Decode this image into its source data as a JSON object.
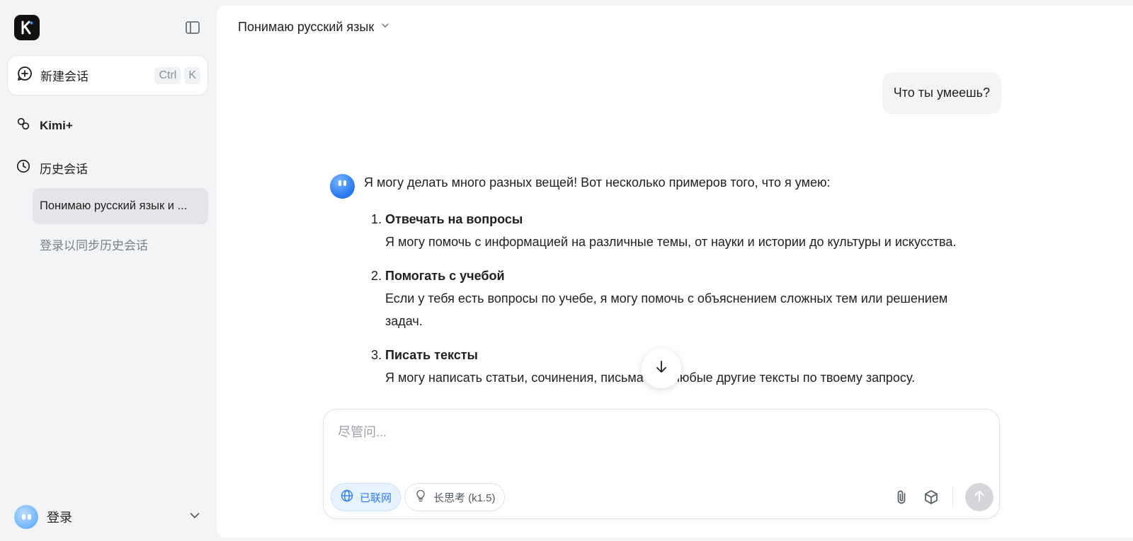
{
  "sidebar": {
    "new_chat_label": "新建会话",
    "shortcut_ctrl": "Ctrl",
    "shortcut_k": "K",
    "kimi_plus_label": "Kimi+",
    "history_label": "历史会话",
    "history_items": [
      {
        "label": "Понимаю русский язык и ..."
      }
    ],
    "login_sync_text": "登录以同步历史会话",
    "login_label": "登录"
  },
  "topbar": {
    "conversation_title": "Понимаю русский язык"
  },
  "conversation": {
    "user_message": "Что ты умеешь?",
    "assistant": {
      "intro": "Я могу делать много разных вещей! Вот несколько примеров того, что я умею:",
      "items": [
        {
          "number": "1.",
          "title": "Отвечать на вопросы",
          "text": "Я могу помочь с информацией на различные темы, от науки и истории до культуры и искусства."
        },
        {
          "number": "2.",
          "title": "Помогать с учебой",
          "text": "Если у тебя есть вопросы по учебе, я могу помочь с объяснением сложных тем или решением задач."
        },
        {
          "number": "3.",
          "title": "Писать тексты",
          "text": "Я могу написать статьи, сочинения, письма или любые другие тексты по твоему запросу."
        }
      ]
    }
  },
  "composer": {
    "placeholder": "尽管问...",
    "web_chip_label": "已联网",
    "think_chip_label": "长思考 (k1.5)"
  },
  "colors": {
    "accent": "#2f7df0",
    "sidebar_bg": "#f3f4f6",
    "bubble_bg": "#f3f4f6",
    "send_disabled": "#d4d6da"
  }
}
